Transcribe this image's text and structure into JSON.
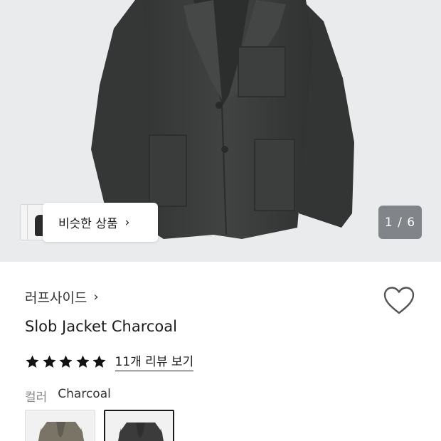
{
  "hero": {
    "similar_label": "비슷한 상품",
    "page_indicator": "1 / 6"
  },
  "product": {
    "brand": "러프사이드",
    "title": "Slob Jacket Charcoal",
    "rating_stars": 5,
    "review_link": "11개 리뷰 보기",
    "liked": false
  },
  "options": {
    "color_label": "컬러",
    "color_value": "Charcoal",
    "swatches": [
      {
        "color": "#7a7466",
        "selected": false
      },
      {
        "color": "#3a3b3a",
        "selected": true
      }
    ]
  },
  "colors": {
    "jacket": "#3b3d3c",
    "background": "#e9ebed",
    "badge": "#6e7276"
  }
}
